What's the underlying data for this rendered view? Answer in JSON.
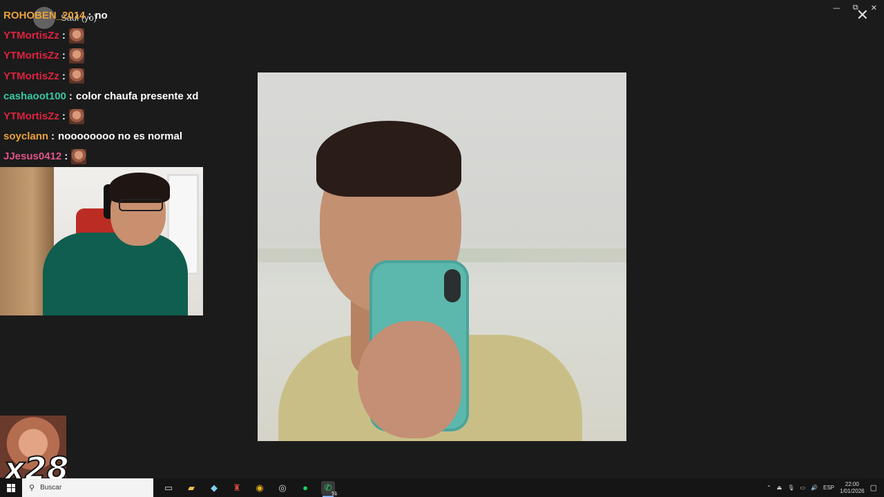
{
  "window": {
    "minimize": "—",
    "maximize": "⧉",
    "close": "✕",
    "close_overlay": "✕"
  },
  "caller": {
    "name": "Saul (yo)"
  },
  "chat": [
    {
      "user": "ROHOBEN_2014",
      "color": "#e8a13a",
      "message": "no"
    },
    {
      "user": "YTMortisZz",
      "color": "#e0223f",
      "message": "",
      "emote": true
    },
    {
      "user": "YTMortisZz",
      "color": "#e0223f",
      "message": "",
      "emote": true
    },
    {
      "user": "YTMortisZz",
      "color": "#e0223f",
      "message": "",
      "emote": true
    },
    {
      "user": "cashaoot100",
      "color": "#36c8a0",
      "message": "color chaufa presente xd"
    },
    {
      "user": "YTMortisZz",
      "color": "#e0223f",
      "message": "",
      "emote": true
    },
    {
      "user": "soyclann",
      "color": "#e8a13a",
      "message": "noooooooo no es normal"
    },
    {
      "user": "JJesus0412",
      "color": "#e0528a",
      "message": "",
      "emote": true
    }
  ],
  "meme": {
    "count": "x28"
  },
  "taskbar": {
    "search_placeholder": "Buscar",
    "whatsapp_badge": "51",
    "language": "ESP",
    "time": "22:00",
    "date": "1/01/2026"
  }
}
